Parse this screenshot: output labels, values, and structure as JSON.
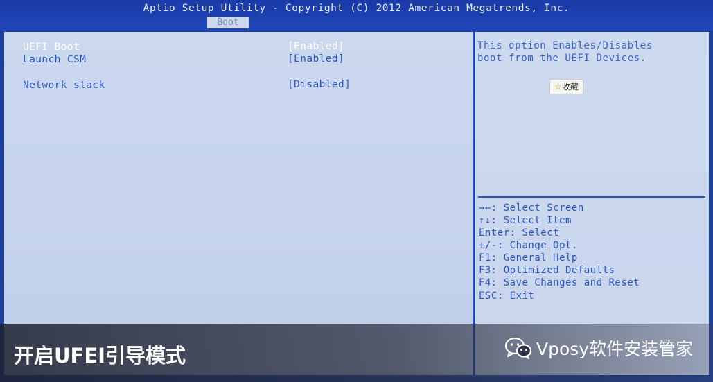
{
  "header": {
    "title": "Aptio Setup Utility - Copyright (C) 2012 American Megatrends, Inc.",
    "tab": "Boot"
  },
  "options": [
    {
      "label": "UEFI Boot",
      "value": "[Enabled]",
      "selected": true
    },
    {
      "label": "Launch CSM",
      "value": "[Enabled]",
      "selected": false
    },
    {
      "label": "Network stack",
      "value": "[Disabled]",
      "selected": false
    }
  ],
  "help": {
    "line1": "This option Enables/Disables",
    "line2": "boot from the UEFI Devices.",
    "favorite_star": "☆",
    "favorite_label": "收藏"
  },
  "keys": [
    "→←: Select Screen",
    "↑↓: Select Item",
    "Enter: Select",
    "+/-: Change Opt.",
    "F1: General Help",
    "F3: Optimized Defaults",
    "F4: Save Changes and Reset",
    "ESC: Exit"
  ],
  "caption": "开启UFEI引导模式",
  "watermark": "Vposy软件安装管家",
  "colors": {
    "panel_bg": "#c8d5ec",
    "frame_blue": "#1c3f9a",
    "text_blue": "#2a56c2",
    "selected_text": "#ffffff"
  }
}
